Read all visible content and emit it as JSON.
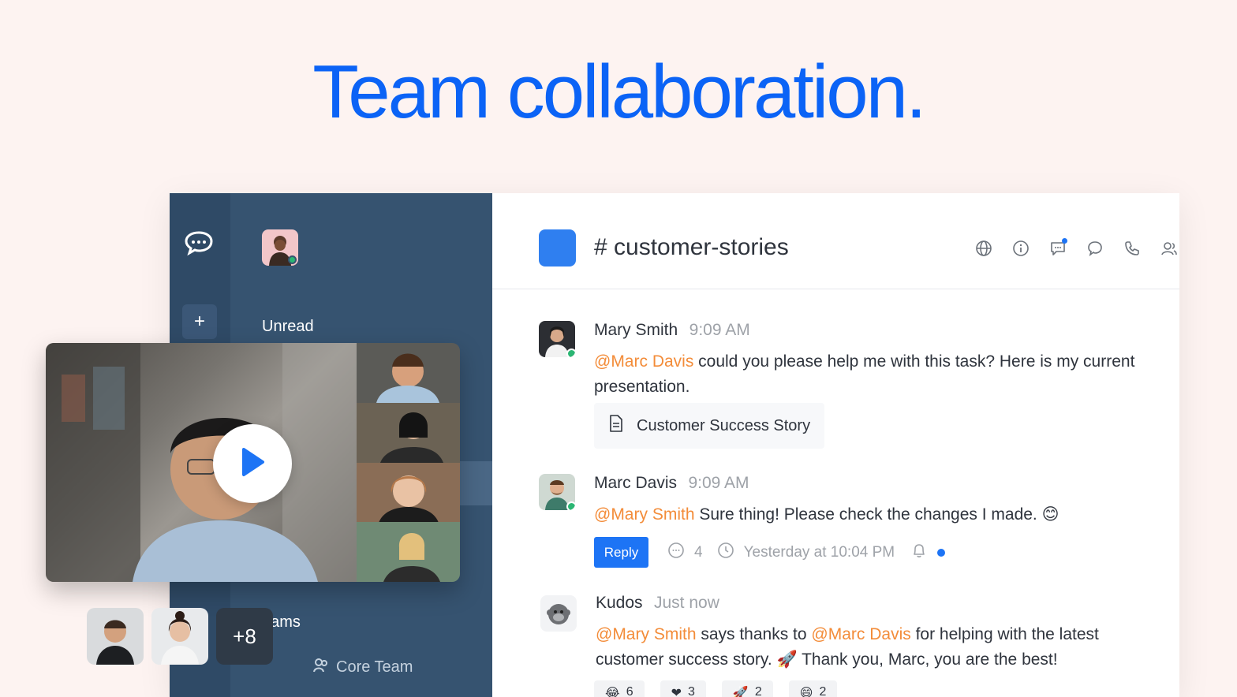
{
  "headline": "Team collaboration.",
  "colors": {
    "accent": "#0b63f6",
    "rail": "#2f4a66",
    "sidebar": "#365370",
    "mention": "#f38c39",
    "reply_button": "#1d74f5",
    "online": "#2bb673"
  },
  "sidebar": {
    "section_unread": "Unread",
    "section_teams": "eams",
    "team_item": "Core Team"
  },
  "room": {
    "name": "# customer-stories",
    "header_icons": [
      "globe-icon",
      "info-icon",
      "discussion-icon",
      "threads-icon",
      "phone-icon",
      "members-icon"
    ]
  },
  "messages": [
    {
      "author": "Mary Smith",
      "time": "9:09 AM",
      "mention": "@Marc Davis",
      "text": " could you please help me with this task? Here is my current presentation.",
      "attachment": "Customer Success Story"
    },
    {
      "author": "Marc Davis",
      "time": "9:09 AM",
      "mention": "@Mary Smith",
      "text": " Sure thing! Please check the changes I made. 😊",
      "reply_label": "Reply",
      "reply_count": "4",
      "reply_time": "Yesterday at 10:04 PM"
    },
    {
      "author": "Kudos",
      "time": "Just now",
      "mention1": "@Mary Smith",
      "text1": " says thanks to ",
      "mention2": "@Marc Davis",
      "text2": " for helping with the latest customer success story. 🚀 Thank you, Marc, you are the best!",
      "reactions": [
        {
          "emoji": "😂",
          "count": "6"
        },
        {
          "emoji": "❤",
          "count": "3"
        },
        {
          "emoji": "🚀",
          "count": "2"
        },
        {
          "emoji": "😄",
          "count": "2"
        }
      ]
    }
  ],
  "video": {
    "extra_participants": "+8"
  }
}
